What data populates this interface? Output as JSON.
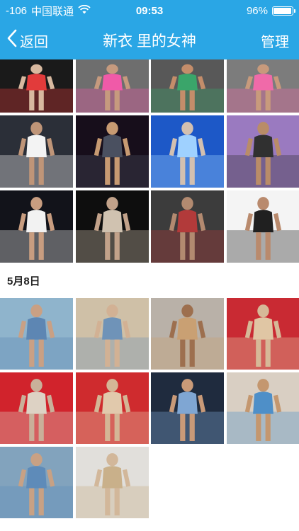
{
  "status_bar": {
    "signal": "-106",
    "carrier": "中国联通",
    "time": "09:53",
    "battery": "96%",
    "battery_level": 0.96,
    "wifi_icon": "wifi-icon",
    "battery_icon": "battery-icon"
  },
  "nav": {
    "back_label": "返回",
    "back_icon": "chevron-left-icon",
    "title": "新衣 里的女神",
    "manage_label": "管理",
    "color": "#2aa6e5"
  },
  "sections": [
    {
      "date": "",
      "photos": [
        {
          "bg": "#1a1a1a",
          "accent": "#e23b3b",
          "figure": "#d8b9a0"
        },
        {
          "bg": "#6e6e6e",
          "accent": "#f05aa8",
          "figure": "#c69a7e"
        },
        {
          "bg": "#585858",
          "accent": "#3aa56a",
          "figure": "#c48d6a"
        },
        {
          "bg": "#7c7c7c",
          "accent": "#f06aa9",
          "figure": "#c89a7c"
        },
        {
          "bg": "#2b2f38",
          "accent": "#f3f3f3",
          "figure": "#bf9578"
        },
        {
          "bg": "#170e1b",
          "accent": "#4a5060",
          "figure": "#c79a72"
        },
        {
          "bg": "#1d58c7",
          "accent": "#9fd1ff",
          "figure": "#d3c0b0"
        },
        {
          "bg": "#9a7ac0",
          "accent": "#303030",
          "figure": "#b98c68"
        },
        {
          "bg": "#12131a",
          "accent": "#f2f2f2",
          "figure": "#c89d80"
        },
        {
          "bg": "#0e0e0e",
          "accent": "#d0c2b0",
          "figure": "#c2a28a"
        },
        {
          "bg": "#3c3c3c",
          "accent": "#b23a3a",
          "figure": "#b28a70"
        },
        {
          "bg": "#f4f4f4",
          "accent": "#202020",
          "figure": "#b98a6d"
        }
      ]
    },
    {
      "date": "5月8日",
      "photos": [
        {
          "bg": "#8fb4cc",
          "accent": "#5d86b3",
          "figure": "#c9a084"
        },
        {
          "bg": "#cfc0a7",
          "accent": "#6f93b8",
          "figure": "#d2b194"
        },
        {
          "bg": "#b9b1a8",
          "accent": "#c9a073",
          "figure": "#9d6f4e"
        },
        {
          "bg": "#c92a33",
          "accent": "#e0c6a4",
          "figure": "#d6b998"
        },
        {
          "bg": "#d1232c",
          "accent": "#ddd2c4",
          "figure": "#c9b09a"
        },
        {
          "bg": "#cf2b2e",
          "accent": "#e1c9ac",
          "figure": "#d4b696"
        },
        {
          "bg": "#1f2b3e",
          "accent": "#7fa6d3",
          "figure": "#c99a78"
        },
        {
          "bg": "#d9cfc3",
          "accent": "#4e8fc8",
          "figure": "#c4976f"
        },
        {
          "bg": "#82a3bd",
          "accent": "#5e8bb9",
          "figure": "#c8a184"
        },
        {
          "bg": "#e1dfdb",
          "accent": "#c9b08a",
          "figure": "#d2b79a"
        }
      ]
    }
  ]
}
